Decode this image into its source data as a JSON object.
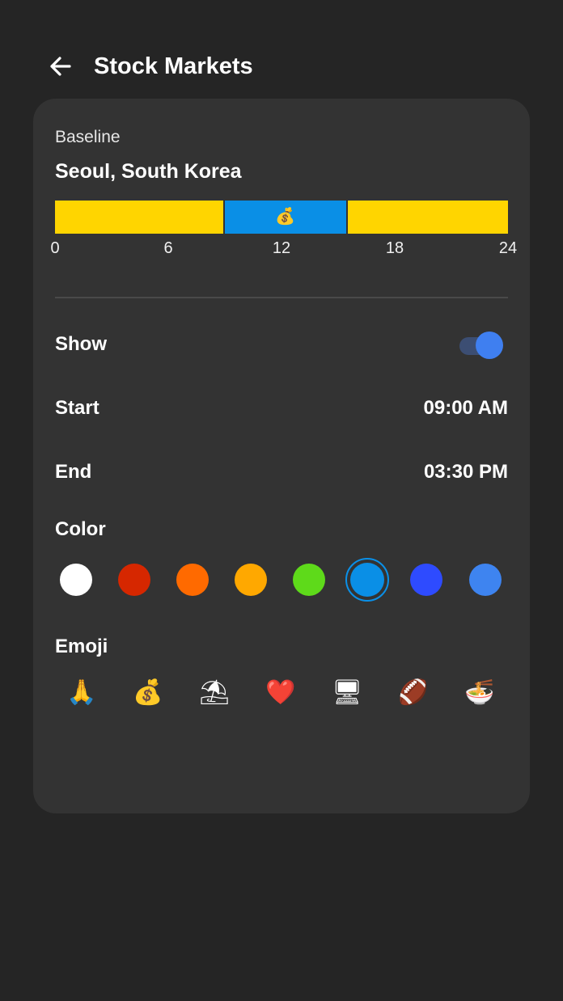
{
  "header": {
    "title": "Stock Markets",
    "back_icon": "arrow-left-icon"
  },
  "baseline": {
    "label": "Baseline",
    "location": "Seoul, South Korea",
    "segments": [
      {
        "from_hour": 0,
        "to_hour": 9,
        "color": "#FFD500"
      },
      {
        "from_hour": 9,
        "to_hour": 15.5,
        "color": "#0A8FE6",
        "emoji": "💰"
      },
      {
        "from_hour": 15.5,
        "to_hour": 24,
        "color": "#FFD500"
      }
    ],
    "ticks": [
      "0",
      "6",
      "12",
      "18",
      "24"
    ]
  },
  "settings": {
    "show_label": "Show",
    "show_enabled": true,
    "start_label": "Start",
    "start_value": "09:00 AM",
    "end_label": "End",
    "end_value": "03:30 PM",
    "color_label": "Color",
    "emoji_label": "Emoji"
  },
  "colors": [
    {
      "name": "white",
      "hex": "#FFFFFF"
    },
    {
      "name": "red",
      "hex": "#D62700"
    },
    {
      "name": "orange",
      "hex": "#FF6A00"
    },
    {
      "name": "amber",
      "hex": "#FFA800"
    },
    {
      "name": "green",
      "hex": "#5EDA1A"
    },
    {
      "name": "sky-blue",
      "hex": "#0A8FE6",
      "selected": true
    },
    {
      "name": "blue",
      "hex": "#2E4BFF"
    },
    {
      "name": "light-blue",
      "hex": "#3E84F0"
    }
  ],
  "emojis": [
    {
      "name": "folded-hands",
      "char": "🙏"
    },
    {
      "name": "money-bag",
      "char": "💰"
    },
    {
      "name": "beach-umbrella",
      "char": "⛱"
    },
    {
      "name": "red-heart",
      "char": "❤️"
    },
    {
      "name": "desktop-computer",
      "char": "🖥"
    },
    {
      "name": "football",
      "char": "🏈"
    },
    {
      "name": "noodle-bowl",
      "char": "🍜"
    }
  ]
}
